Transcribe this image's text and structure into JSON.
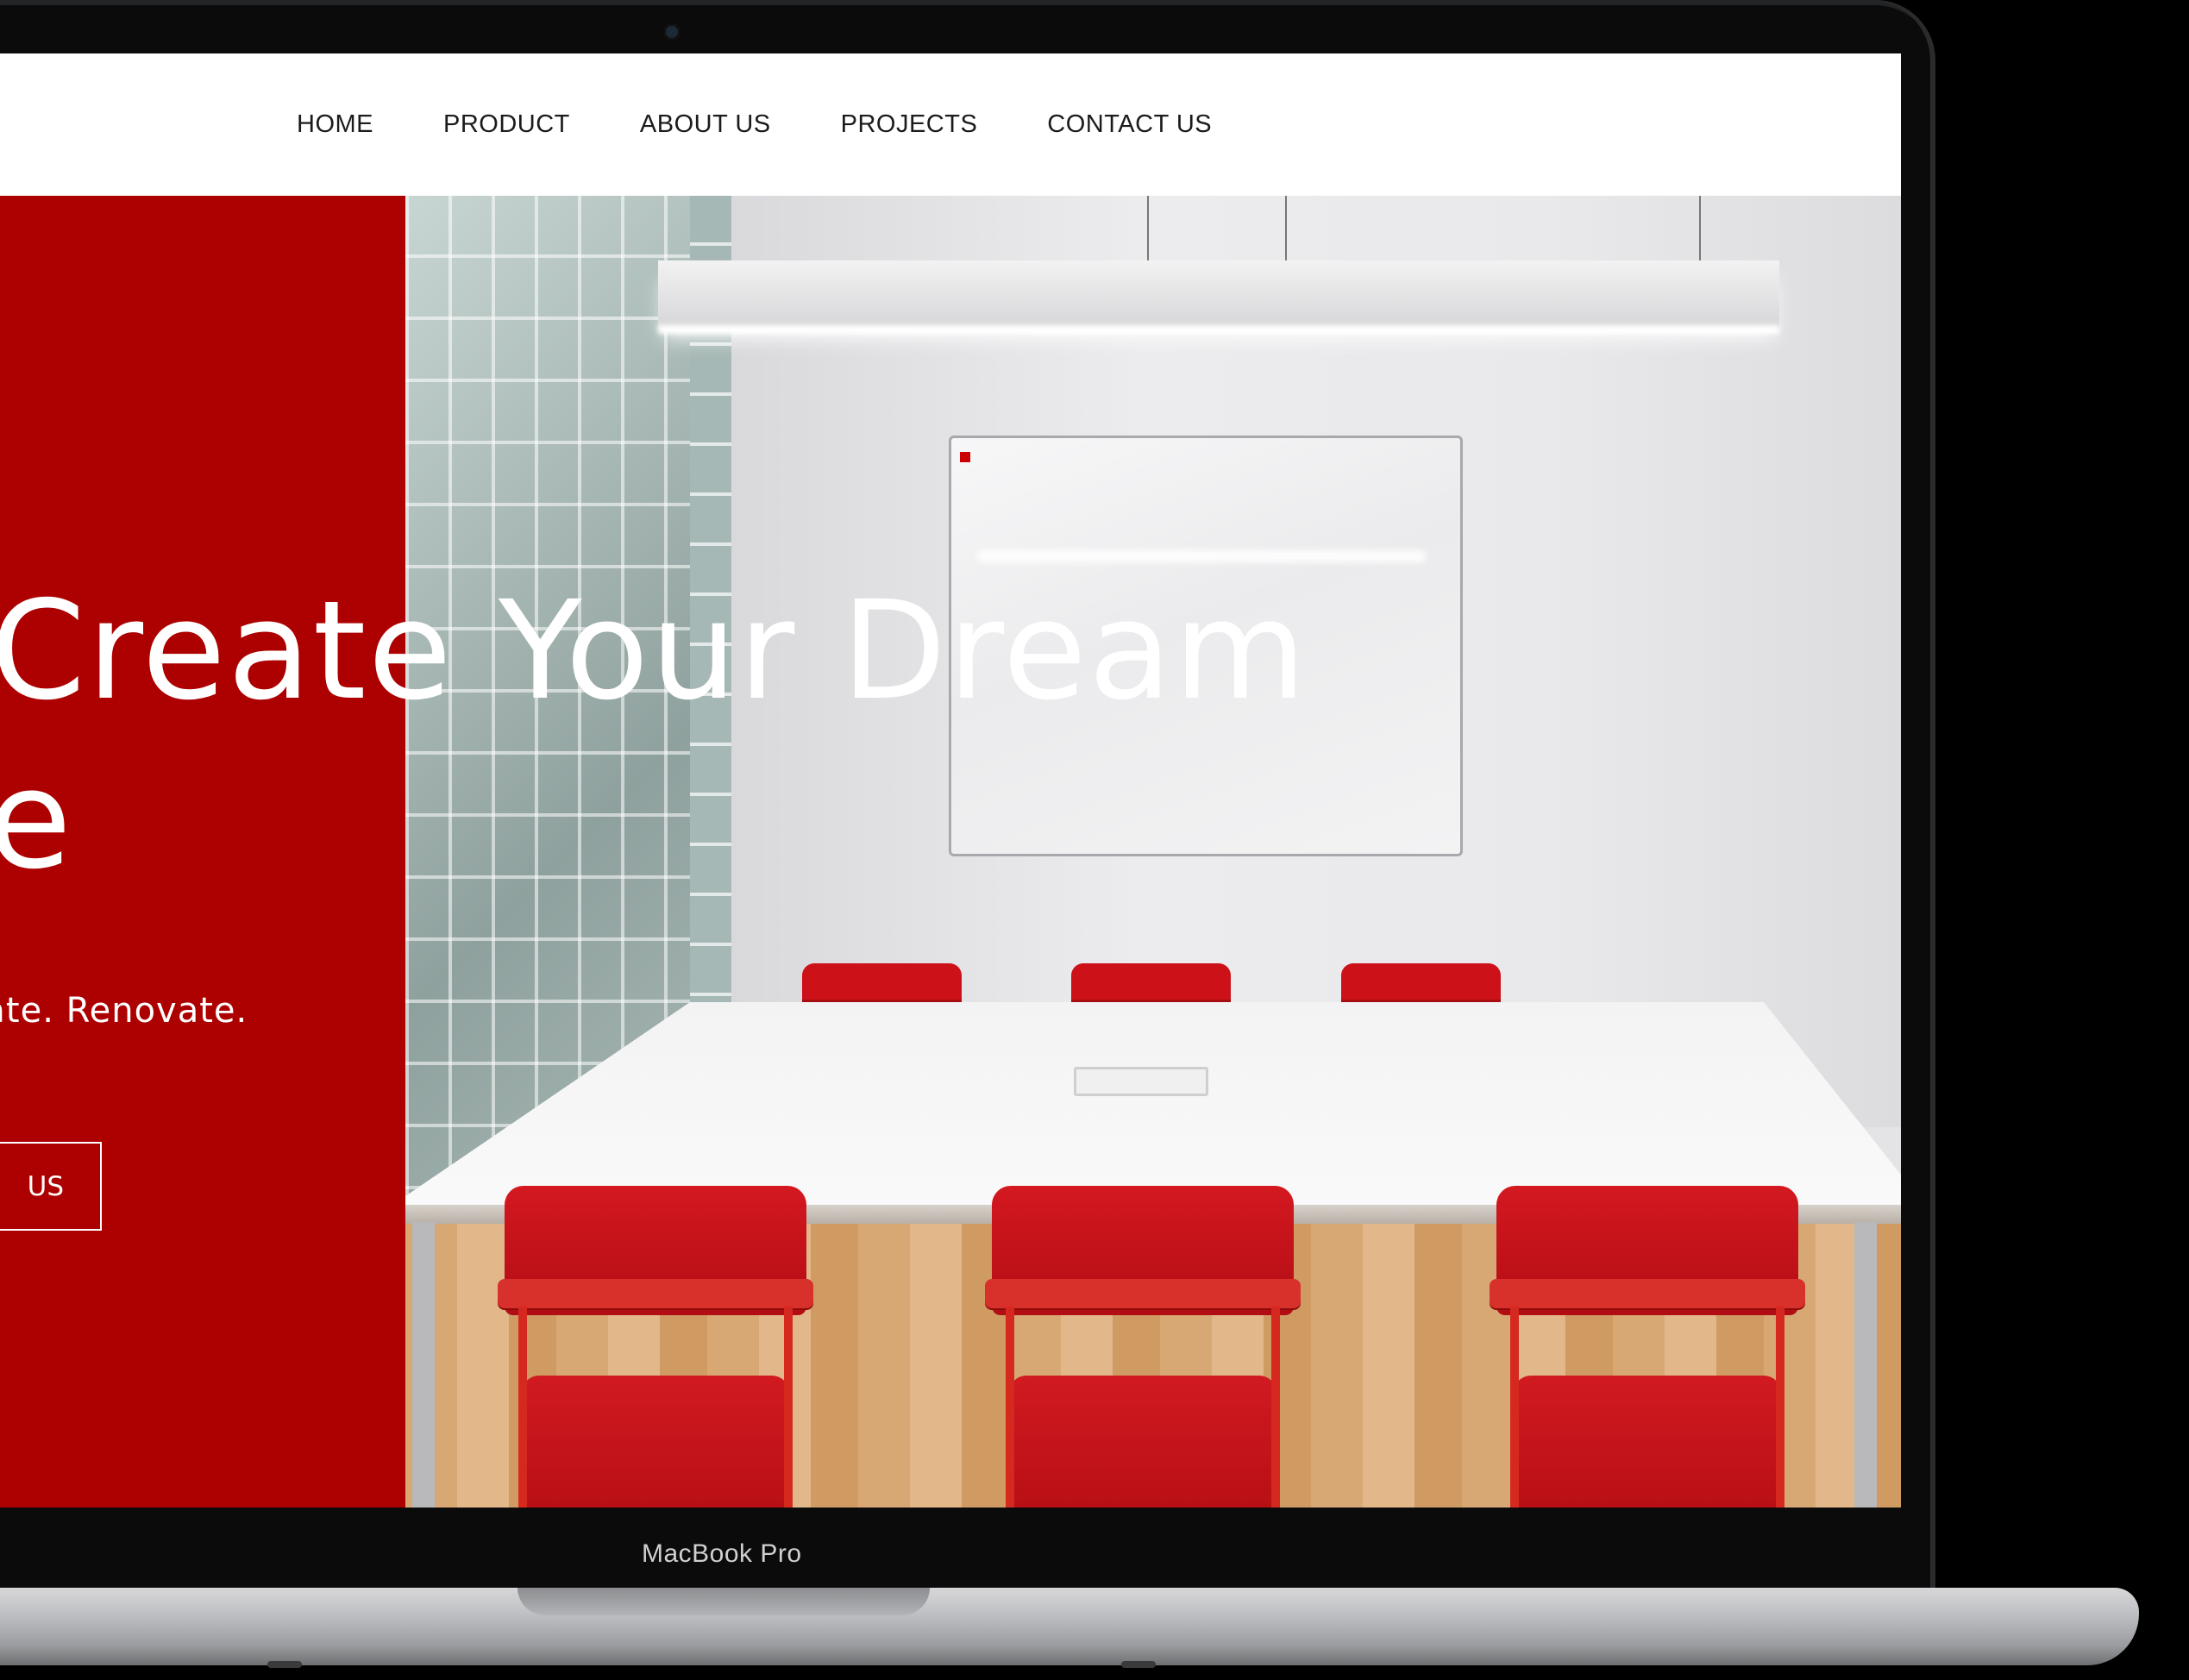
{
  "nav": {
    "items": [
      {
        "label": "HOME"
      },
      {
        "label": "PRODUCT"
      },
      {
        "label": "ABOUT US"
      },
      {
        "label": "PROJECTS"
      },
      {
        "label": "CONTACT US"
      }
    ]
  },
  "hero": {
    "title_line1": "’s Create Your Dream",
    "title_line2": "ace",
    "subtitle": "date. Renovate.",
    "cta_label": "US"
  },
  "device": {
    "label": "MacBook Pro"
  },
  "colors": {
    "accent_red": "#ad0000",
    "nav_background": "#ffffff",
    "nav_text": "#1b1b1b",
    "hero_text": "#ffffff"
  },
  "icons": {
    "camera": "webcam-dot"
  }
}
